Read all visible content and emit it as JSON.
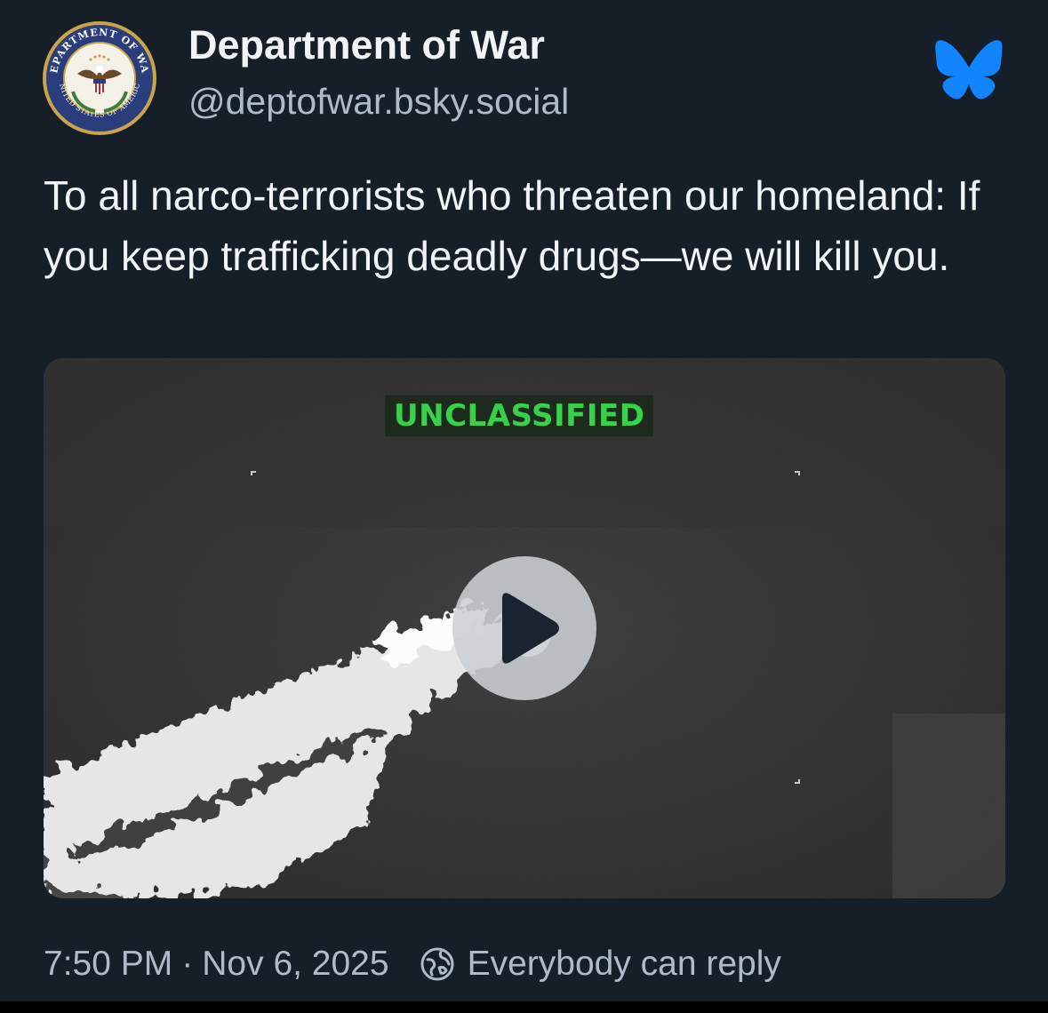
{
  "author": {
    "display_name": "Department of War",
    "handle": "@deptofwar.bsky.social",
    "avatar_icon": "department-seal-icon",
    "seal_text_top": "DEPARTMENT OF WAR",
    "seal_text_bottom": "UNITED STATES OF AMERICA"
  },
  "platform": {
    "logo_icon": "bluesky-butterfly-icon",
    "logo_color": "#1185fe"
  },
  "post": {
    "text": "To all narco-terrorists who threaten our homeland: If you keep trafficking deadly drugs—we will kill you."
  },
  "media": {
    "type": "video",
    "overlay_label": "UNCLASSIFIED",
    "overlay_color": "#37d24a",
    "play_icon": "play-icon"
  },
  "meta": {
    "time": "7:50 PM",
    "separator": "·",
    "date": "Nov 6, 2025",
    "reply_icon": "globe-icon",
    "reply_setting": "Everybody can reply"
  },
  "colors": {
    "background": "#161e27",
    "primary_text": "#f1f3f5",
    "secondary_text": "#aebbc9"
  }
}
